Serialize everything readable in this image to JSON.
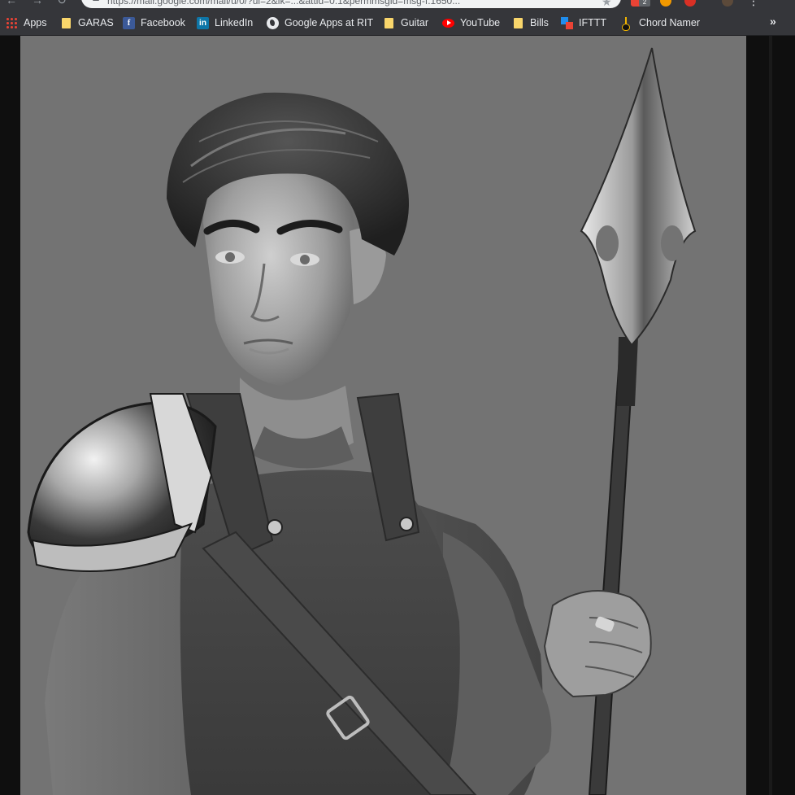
{
  "browser": {
    "url": "https://mail.google.com/mail/u/0/?ui=2&ik=...&attid=0.1&permmsgid=msg-f:1650..."
  },
  "extensions": {
    "badge_count": "2"
  },
  "bookmarks": [
    {
      "label": "Apps",
      "icon": "apps-grid-icon"
    },
    {
      "label": "GARAS",
      "icon": "folder-icon"
    },
    {
      "label": "Facebook",
      "icon": "facebook-icon"
    },
    {
      "label": "LinkedIn",
      "icon": "linkedin-icon"
    },
    {
      "label": "Google Apps at RIT",
      "icon": "globe-icon"
    },
    {
      "label": "Guitar",
      "icon": "folder-icon"
    },
    {
      "label": "YouTube",
      "icon": "youtube-icon"
    },
    {
      "label": "Bills",
      "icon": "folder-icon"
    },
    {
      "label": "IFTTT",
      "icon": "ifttt-icon"
    },
    {
      "label": "Chord Namer",
      "icon": "guitar-icon"
    }
  ],
  "overflow_label": "»",
  "colors": {
    "chrome_bg": "#35363a",
    "page_bg": "#0f0f0f",
    "canvas_bg": "#737373"
  }
}
